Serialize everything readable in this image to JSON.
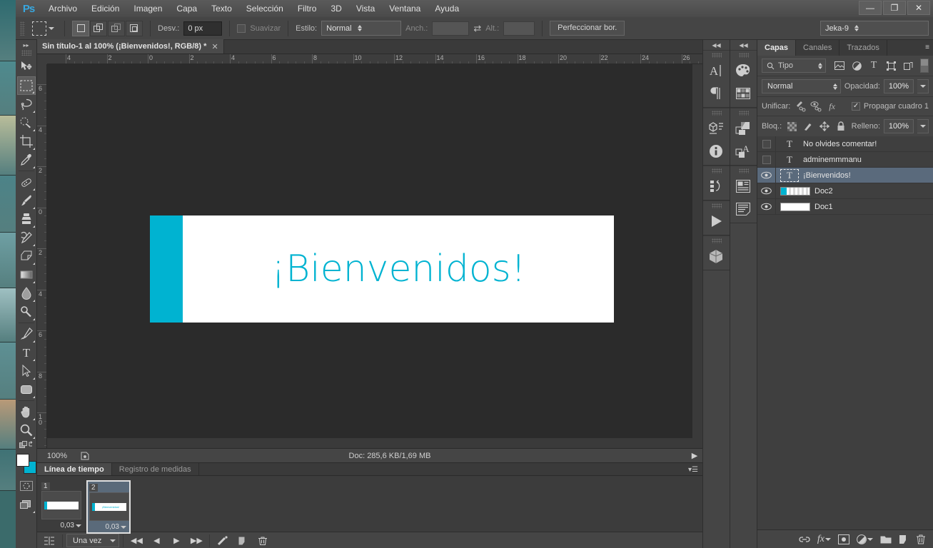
{
  "app": {
    "logo": "Ps"
  },
  "menubar": {
    "items": [
      {
        "label": "Archivo"
      },
      {
        "label": "Edición"
      },
      {
        "label": "Imagen"
      },
      {
        "label": "Capa"
      },
      {
        "label": "Texto"
      },
      {
        "label": "Selección"
      },
      {
        "label": "Filtro"
      },
      {
        "label": "3D"
      },
      {
        "label": "Vista"
      },
      {
        "label": "Ventana"
      },
      {
        "label": "Ayuda"
      }
    ]
  },
  "window_controls": {
    "minimize": "—",
    "restore": "❐",
    "close": "✕"
  },
  "options_bar": {
    "tool_icon": "rectangular-marquee",
    "feather_label": "Desv.:",
    "feather_value": "0 px",
    "antialias_label": "Suavizar",
    "antialias_checked": false,
    "style_label": "Estilo:",
    "style_value": "Normal",
    "width_label": "Anch.:",
    "width_value": "",
    "height_label": "Alt.:",
    "height_value": "",
    "swap_icon": "swap-arrows-icon",
    "refine_edge_label": "Perfeccionar bor.",
    "workspace_value": "Jeka-9"
  },
  "toolbar": {
    "tools_top": [
      {
        "name": "move-tool",
        "glyph": "move"
      },
      {
        "name": "rectangular-marquee-tool",
        "glyph": "marquee",
        "active": true
      },
      {
        "name": "lasso-tool",
        "glyph": "lasso"
      },
      {
        "name": "quick-selection-tool",
        "glyph": "quickselect"
      },
      {
        "name": "crop-tool",
        "glyph": "crop"
      },
      {
        "name": "eyedropper-tool",
        "glyph": "eyedropper"
      }
    ],
    "tools_mid": [
      {
        "name": "spot-healing-brush-tool",
        "glyph": "healing"
      },
      {
        "name": "brush-tool",
        "glyph": "brush"
      },
      {
        "name": "clone-stamp-tool",
        "glyph": "stamp"
      },
      {
        "name": "history-brush-tool",
        "glyph": "historybrush"
      },
      {
        "name": "eraser-tool",
        "glyph": "eraser"
      },
      {
        "name": "gradient-tool",
        "glyph": "gradient"
      },
      {
        "name": "blur-tool",
        "glyph": "blur"
      },
      {
        "name": "dodge-tool",
        "glyph": "dodge"
      }
    ],
    "tools_vector": [
      {
        "name": "pen-tool",
        "glyph": "pen"
      },
      {
        "name": "horizontal-type-tool",
        "glyph": "type"
      },
      {
        "name": "path-selection-tool",
        "glyph": "pathselect"
      },
      {
        "name": "rectangle-tool",
        "glyph": "shape"
      }
    ],
    "tools_nav": [
      {
        "name": "hand-tool",
        "glyph": "hand"
      },
      {
        "name": "zoom-tool",
        "glyph": "zoom"
      }
    ],
    "foreground_color": "#ffffff",
    "background_color": "#00b3d1",
    "quick_mask_name": "quick-mask-toggle",
    "screen_mode_name": "screen-mode-toggle"
  },
  "document": {
    "tab_title": "Sin título-1 al 100% (¡Bienvenidos!, RGB/8) *",
    "close_glyph": "✕"
  },
  "rulers": {
    "horizontal": [
      "4",
      "2",
      "0",
      "2",
      "4",
      "6",
      "8",
      "10",
      "12",
      "14",
      "16",
      "18",
      "20",
      "22",
      "24",
      "26"
    ],
    "vertical": [
      "6",
      "4",
      "2",
      "0",
      "2",
      "4",
      "6",
      "8",
      "10"
    ]
  },
  "canvas": {
    "text": "¡Bienvenidos!",
    "text_color": "#00b3d1",
    "bar_color": "#00b3d1",
    "background_color": "#ffffff"
  },
  "status_bar": {
    "zoom": "100%",
    "doc_info": "Doc: 285,6 KB/1,69 MB",
    "arrow_glyph": "▶"
  },
  "timeline": {
    "tabs": [
      {
        "label": "Línea de tiempo",
        "active": true
      },
      {
        "label": "Registro de medidas",
        "active": false
      }
    ],
    "frames": [
      {
        "number": "1",
        "delay": "0,03",
        "selected": false,
        "has_text": false
      },
      {
        "number": "2",
        "delay": "0,03",
        "selected": true,
        "has_text": true
      }
    ],
    "loop_value": "Una vez",
    "controls": [
      {
        "name": "convert-to-video-timeline-button",
        "glyph": "timeline"
      },
      {
        "name": "select-first-frame-button",
        "glyph": "◀◀"
      },
      {
        "name": "select-previous-frame-button",
        "glyph": "◀"
      },
      {
        "name": "play-animation-button",
        "glyph": "▶"
      },
      {
        "name": "select-next-frame-button",
        "glyph": "▶▶"
      },
      {
        "name": "tween-frames-button",
        "glyph": "tween"
      },
      {
        "name": "duplicate-frame-button",
        "glyph": "duplicate"
      },
      {
        "name": "delete-frame-button",
        "glyph": "trash"
      }
    ]
  },
  "icon_docks": {
    "column_a": [
      {
        "name": "character-panel-icon",
        "glyph": "char"
      },
      {
        "name": "paragraph-panel-icon",
        "glyph": "para"
      },
      {
        "name": "3d-panel-icon",
        "glyph": "3dpanel"
      },
      {
        "name": "info-panel-icon",
        "glyph": "info"
      },
      {
        "name": "history-panel-icon",
        "glyph": "history"
      },
      {
        "name": "animation-panel-icon",
        "glyph": "play"
      },
      {
        "name": "3d-scene-panel-icon",
        "glyph": "cube"
      }
    ],
    "column_b": [
      {
        "name": "color-panel-icon",
        "glyph": "palette"
      },
      {
        "name": "swatches-panel-icon",
        "glyph": "swatches"
      },
      {
        "name": "adjustments-panel-icon",
        "glyph": "adjust"
      },
      {
        "name": "styles-panel-icon",
        "glyph": "stylesA"
      },
      {
        "name": "layer-comps-panel-icon",
        "glyph": "comps"
      },
      {
        "name": "notes-panel-icon",
        "glyph": "notes"
      }
    ],
    "collapse_glyph": "◀◀"
  },
  "layers_panel": {
    "tabs": [
      {
        "label": "Capas",
        "active": true
      },
      {
        "label": "Canales",
        "active": false
      },
      {
        "label": "Trazados",
        "active": false
      }
    ],
    "menu_glyph": "≡",
    "filter_label": "Tipo",
    "filter_icons": [
      {
        "name": "filter-pixel-layers-icon"
      },
      {
        "name": "filter-adjustment-layers-icon"
      },
      {
        "name": "filter-type-layers-icon"
      },
      {
        "name": "filter-shape-layers-icon"
      },
      {
        "name": "filter-smart-object-layers-icon"
      }
    ],
    "blend_mode": "Normal",
    "opacity_label": "Opacidad:",
    "opacity_value": "100%",
    "unify_label": "Unificar:",
    "unify_icons": [
      {
        "name": "unify-position-icon"
      },
      {
        "name": "unify-visibility-icon"
      },
      {
        "name": "unify-style-icon"
      }
    ],
    "propagate_label": "Propagar cuadro 1",
    "propagate_checked": true,
    "lock_label": "Bloq.:",
    "lock_icons": [
      {
        "name": "lock-transparent-pixels-icon"
      },
      {
        "name": "lock-image-pixels-icon"
      },
      {
        "name": "lock-position-icon"
      },
      {
        "name": "lock-all-icon"
      }
    ],
    "fill_label": "Relleno:",
    "fill_value": "100%",
    "layers": [
      {
        "name": "No olvides comentar!",
        "visible": false,
        "type": "text",
        "selected": false
      },
      {
        "name": "adminemmmanu",
        "visible": false,
        "type": "text",
        "selected": false
      },
      {
        "name": "¡Bienvenidos!",
        "visible": true,
        "type": "text",
        "selected": true
      },
      {
        "name": "Doc2",
        "visible": true,
        "type": "image",
        "selected": false
      },
      {
        "name": "Doc1",
        "visible": true,
        "type": "image",
        "selected": false
      }
    ],
    "bottom_buttons": [
      {
        "name": "link-layers-button",
        "glyph": "link"
      },
      {
        "name": "layer-style-button",
        "glyph": "fx"
      },
      {
        "name": "add-layer-mask-button",
        "glyph": "mask"
      },
      {
        "name": "new-adjustment-layer-button",
        "glyph": "adjust"
      },
      {
        "name": "new-group-button",
        "glyph": "folder"
      },
      {
        "name": "new-layer-button",
        "glyph": "newlayer"
      },
      {
        "name": "delete-layer-button",
        "glyph": "trash"
      }
    ]
  }
}
